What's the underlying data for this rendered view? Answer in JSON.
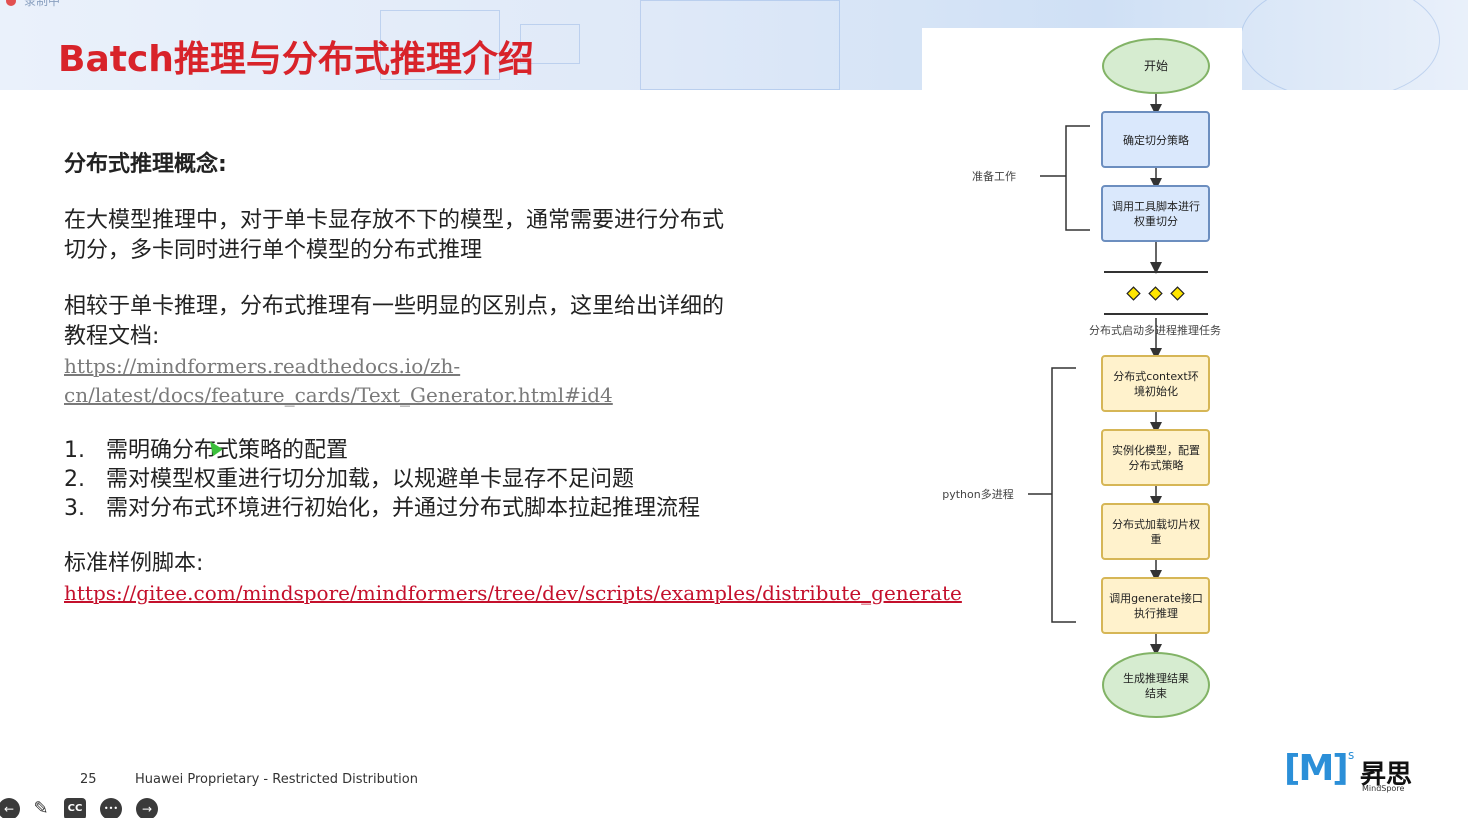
{
  "header": {
    "recording_label": "录制中",
    "title": "Batch推理与分布式推理介绍"
  },
  "content": {
    "concept_title": "分布式推理概念:",
    "para1": "在大模型推理中，对于单卡显存放不下的模型，通常需要进行分布式切分，多卡同时进行单个模型的分布式推理",
    "para2": "相较于单卡推理，分布式推理有一些明显的区别点，这里给出详细的教程文档:",
    "doc_link": "https://mindformers.readthedocs.io/zh-cn/latest/docs/feature_cards/Text_Generator.html#id4",
    "requirements": [
      {
        "num": "1.",
        "text": "需明确分布式策略的配置"
      },
      {
        "num": "2.",
        "text": "需对模型权重进行切分加载，以规避单卡显存不足问题"
      },
      {
        "num": "3.",
        "text": "需对分布式环境进行初始化，并通过分布式脚本拉起推理流程"
      }
    ],
    "sample_label": "标准样例脚本:",
    "sample_link": "https://gitee.com/mindspore/mindformers/tree/dev/scripts/examples/distribute_generate"
  },
  "flowchart": {
    "start": "开始",
    "step1": "确定切分策略",
    "step2_line1": "调用工具脚本进行",
    "step2_line2": "权重切分",
    "prep_label": "准备工作",
    "fork_label": "分布式启动多进程推理任务",
    "step3_line1": "分布式context环",
    "step3_line2": "境初始化",
    "step4_line1": "实例化模型，配置",
    "step4_line2": "分布式策略",
    "step5_line1": "分布式加载切片权",
    "step5_line2": "重",
    "step6_line1": "调用generate接口",
    "step6_line2": "执行推理",
    "python_label": "python多进程",
    "end_line1": "生成推理结果",
    "end_line2": "结束"
  },
  "footer": {
    "page_number": "25",
    "text": "Huawei Proprietary - Restricted Distribution"
  },
  "toolbar": {
    "back_icon": "←",
    "pen_icon": "✎",
    "cc_label": "CC",
    "more_icon": "•••",
    "forward_icon": "→"
  },
  "logo": {
    "mark": "[M]",
    "sup": "s",
    "cn": "昇思",
    "en": "MindSpore"
  },
  "colors": {
    "title": "#d8232a",
    "link_red": "#c4102c",
    "start_fill": "#d6ecd0",
    "start_stroke": "#82b366",
    "blue_fill": "#dae8fc",
    "blue_stroke": "#6c8ebf",
    "yellow_fill": "#fff2cc",
    "yellow_stroke": "#d6b656",
    "logo_blue": "#2b8fd8"
  }
}
